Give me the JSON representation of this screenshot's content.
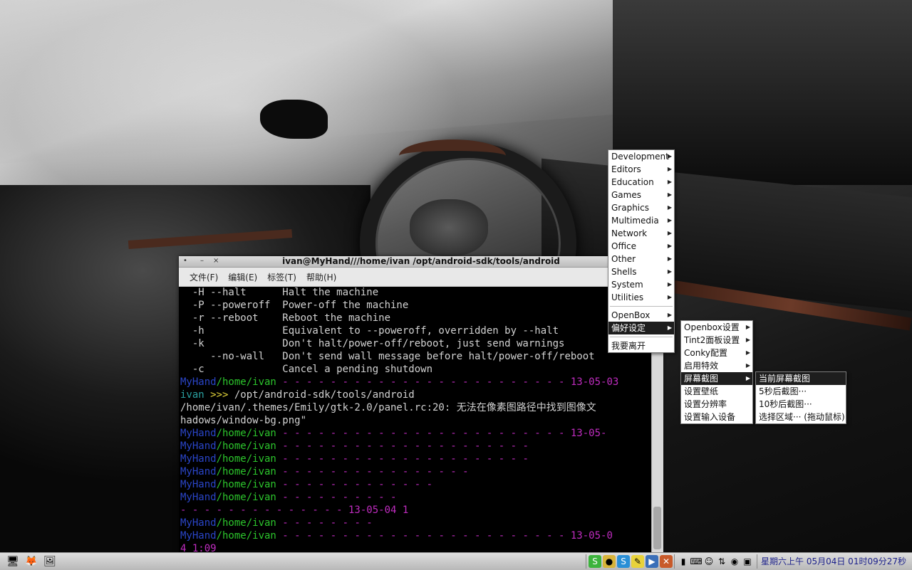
{
  "terminal": {
    "title": "ivan@MyHand///home/ivan /opt/android-sdk/tools/android",
    "controls": [
      "•",
      "–",
      "×"
    ],
    "menu": [
      "文件(F)",
      "编辑(E)",
      "标签(T)",
      "帮助(H)"
    ],
    "lines": [
      {
        "segments": [
          {
            "t": "  -H --halt      Halt the machine",
            "c": "c-text"
          }
        ]
      },
      {
        "segments": [
          {
            "t": "  -P --poweroff  Power-off the machine",
            "c": "c-text"
          }
        ]
      },
      {
        "segments": [
          {
            "t": "  -r --reboot    Reboot the machine",
            "c": "c-text"
          }
        ]
      },
      {
        "segments": [
          {
            "t": "  -h             Equivalent to --poweroff, overridden by --halt",
            "c": "c-text"
          }
        ]
      },
      {
        "segments": [
          {
            "t": "  -k             Don't halt/power-off/reboot, just send warnings",
            "c": "c-text"
          }
        ]
      },
      {
        "segments": [
          {
            "t": "     --no-wall   Don't send wall message before halt/power-off/reboot",
            "c": "c-text"
          }
        ]
      },
      {
        "segments": [
          {
            "t": "  -c             Cancel a pending shutdown",
            "c": "c-text"
          }
        ]
      },
      {
        "segments": [
          {
            "t": "MyHand",
            "c": "c-host"
          },
          {
            "t": "/home/ivan",
            "c": "c-path"
          },
          {
            "t": " - - - - - - - - - - - - - - - - - - - - - - - - 13-05-03",
            "c": "c-dash"
          }
        ]
      },
      {
        "segments": [
          {
            "t": "ivan",
            "c": "c-user"
          },
          {
            "t": " >>> ",
            "c": "c-prompt"
          },
          {
            "t": "/opt/android-sdk/tools/android",
            "c": "c-text"
          }
        ]
      },
      {
        "segments": [
          {
            "t": "/home/ivan/.themes/Emily/gtk-2.0/panel.rc:20: 无法在像素图路径中找到图像文",
            "c": "c-text"
          }
        ]
      },
      {
        "segments": [
          {
            "t": "hadows/window-bg.png\"",
            "c": "c-text"
          }
        ]
      },
      {
        "segments": [
          {
            "t": "MyHand",
            "c": "c-host"
          },
          {
            "t": "/home/ivan",
            "c": "c-path"
          },
          {
            "t": " - - - - - - - - - - - - - - - - - - - - - - - - 13-05-",
            "c": "c-dash"
          }
        ]
      },
      {
        "segments": [
          {
            "t": "MyHand",
            "c": "c-host"
          },
          {
            "t": "/home/ivan",
            "c": "c-path"
          },
          {
            "t": " - - - - - - - - - - - - - - - - - - - - -",
            "c": "c-dash"
          }
        ]
      },
      {
        "segments": [
          {
            "t": "MyHand",
            "c": "c-host"
          },
          {
            "t": "/home/ivan",
            "c": "c-path"
          },
          {
            "t": " - - - - - - - - - - - - - - - - - - - - -",
            "c": "c-dash"
          }
        ]
      },
      {
        "segments": [
          {
            "t": "MyHand",
            "c": "c-host"
          },
          {
            "t": "/home/ivan",
            "c": "c-path"
          },
          {
            "t": " - - - - - - - - - - - - - - - -",
            "c": "c-dash"
          }
        ]
      },
      {
        "segments": [
          {
            "t": "MyHand",
            "c": "c-host"
          },
          {
            "t": "/home/ivan",
            "c": "c-path"
          },
          {
            "t": " - - - - - - - - - - - - -",
            "c": "c-dash"
          }
        ]
      },
      {
        "segments": [
          {
            "t": "MyHand",
            "c": "c-host"
          },
          {
            "t": "/home/ivan",
            "c": "c-path"
          },
          {
            "t": " - - - - - - - - - -",
            "c": "c-dash"
          }
        ]
      },
      {
        "segments": [
          {
            "t": "- - - - - - - - - - - - - - 13-05-04 1",
            "c": "c-dash"
          }
        ]
      },
      {
        "segments": [
          {
            "t": "MyHand",
            "c": "c-host"
          },
          {
            "t": "/home/ivan",
            "c": "c-path"
          },
          {
            "t": " - - - - - - - -",
            "c": "c-dash"
          }
        ]
      },
      {
        "segments": [
          {
            "t": "MyHand",
            "c": "c-host"
          },
          {
            "t": "/home/ivan",
            "c": "c-path"
          },
          {
            "t": " - - - - - - - - - - - - - - - - - - - - - - - - 13-05-0",
            "c": "c-dash"
          }
        ]
      },
      {
        "segments": [
          {
            "t": "4 1:09",
            "c": "c-dash"
          }
        ]
      }
    ]
  },
  "main_menu": {
    "items": [
      {
        "label": "Development",
        "submenu": true
      },
      {
        "label": "Editors",
        "submenu": true
      },
      {
        "label": "Education",
        "submenu": true
      },
      {
        "label": "Games",
        "submenu": true
      },
      {
        "label": "Graphics",
        "submenu": true
      },
      {
        "label": "Multimedia",
        "submenu": true
      },
      {
        "label": "Network",
        "submenu": true
      },
      {
        "label": "Office",
        "submenu": true
      },
      {
        "label": "Other",
        "submenu": true
      },
      {
        "label": "Shells",
        "submenu": true
      },
      {
        "label": "System",
        "submenu": true
      },
      {
        "label": "Utilities",
        "submenu": true
      }
    ],
    "openbox": "OpenBox",
    "preferences": "偏好设定",
    "logout": "我要离开"
  },
  "pref_menu": {
    "items": [
      {
        "label": "Openbox设置",
        "submenu": true
      },
      {
        "label": "Tint2面板设置",
        "submenu": true
      },
      {
        "label": "Conky配置",
        "submenu": true
      },
      {
        "label": "启用特效",
        "submenu": true
      },
      {
        "label": "屏幕截图",
        "submenu": true,
        "active": true
      },
      {
        "label": "设置壁纸",
        "submenu": false
      },
      {
        "label": "设置分辨率",
        "submenu": false
      },
      {
        "label": "设置输入设备",
        "submenu": false
      }
    ]
  },
  "screenshot_menu": {
    "items": [
      {
        "label": "当前屏幕截图",
        "active": true
      },
      {
        "label": "5秒后截图···"
      },
      {
        "label": "10秒后截图···"
      },
      {
        "label": "选择区域··· (拖动鼠标)"
      }
    ]
  },
  "taskbar": {
    "launchers": [
      "desktop-icon",
      "firefox-icon",
      "image-viewer-icon"
    ],
    "tray": [
      "skype-icon",
      "chat-icon",
      "skype-alt-icon",
      "notes-icon",
      "media-icon",
      "tools-icon",
      "battery-icon",
      "keyboard-icon",
      "qq-icon",
      "network-icon",
      "volume-icon",
      "display-icon"
    ],
    "clock": "星期六上午 05月04日 01时09分27秒"
  },
  "colors": {
    "host": "#2a45c8",
    "path": "#2cc52c",
    "dash": "#c02cc0",
    "user": "#2aa0a0",
    "prompt": "#e0d23a",
    "menu_active": "#1e1e1e",
    "clock": "#1a1f8a"
  }
}
